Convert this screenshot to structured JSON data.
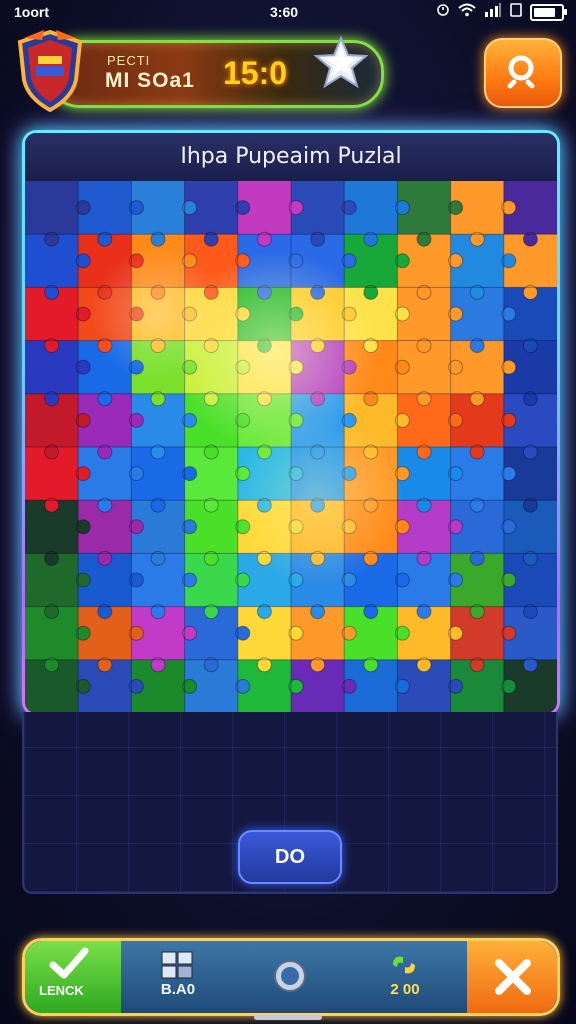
{
  "status_bar": {
    "left_text": "1oort",
    "time": "3:60"
  },
  "header": {
    "label_top": "PECTI",
    "label_main": "MI SOa1",
    "score": "15:0"
  },
  "puzzle": {
    "title": "Ihpa Pupeaim Puzlal",
    "rows": 10,
    "cols": 10,
    "colors": [
      [
        "#2b3a9a",
        "#1f5ad0",
        "#2a7fd8",
        "#2f3fae",
        "#c23ac0",
        "#2a4ab8",
        "#1f78d8",
        "#2d7a3a",
        "#ff9a2a",
        "#4a2a9a"
      ],
      [
        "#1f4fd0",
        "#e8301a",
        "#ff8a1a",
        "#ff5a1a",
        "#2a6ae8",
        "#2a6ae8",
        "#18a83a",
        "#ff9a2a",
        "#1f8ae0",
        "#ff9a2a"
      ],
      [
        "#e21a2a",
        "#f24a1a",
        "#ffbe2a",
        "#ffd83a",
        "#1fb82a",
        "#ffca2a",
        "#ffe24a",
        "#ff9a2a",
        "#2a7ae0",
        "#1a4ab8"
      ],
      [
        "#2a3ac0",
        "#1a6ae8",
        "#7ae02a",
        "#c8f03a",
        "#ffe04a",
        "#b43ac8",
        "#ff8a1a",
        "#ff9a2a",
        "#ff9a2a",
        "#1a3aa8"
      ],
      [
        "#c21a2a",
        "#9a2ab8",
        "#2a8ae8",
        "#4ae02a",
        "#6ae83a",
        "#2a9af0",
        "#ffba2a",
        "#ff6a1a",
        "#e23a1a",
        "#2a4ac0"
      ],
      [
        "#e21a2a",
        "#2a7ae8",
        "#1a6ae8",
        "#5ae83a",
        "#2ab8e8",
        "#2a9af0",
        "#ff9a2a",
        "#1a8ae8",
        "#2a7ae8",
        "#1a3a9a"
      ],
      [
        "#1a3a2a",
        "#9a2aa8",
        "#2a7ad8",
        "#4ae02a",
        "#ffd83a",
        "#ffb82a",
        "#ff8a1a",
        "#b43ac8",
        "#2a6ad8",
        "#1a5ab8"
      ],
      [
        "#1f6a2a",
        "#1a5ad0",
        "#2a7ae8",
        "#3ad84a",
        "#2aa8e8",
        "#2a8ae8",
        "#1a6ae8",
        "#2a7ae8",
        "#3aa82a",
        "#1a4ab8"
      ],
      [
        "#1f8a2a",
        "#e2601a",
        "#c23ac8",
        "#2a6ad8",
        "#ffd83a",
        "#ff9a2a",
        "#4ae02a",
        "#ffba2a",
        "#d23a2a",
        "#2a5ac8"
      ],
      [
        "#1a5a2a",
        "#2a4ab8",
        "#1a8a2a",
        "#2a7ad8",
        "#1fb83a",
        "#6a2ab8",
        "#1a6ad8",
        "#2a4ab8",
        "#1a8a3a",
        "#1a3a2a"
      ]
    ]
  },
  "action": {
    "do_label": "DO"
  },
  "bottom_bar": {
    "check_label": "LENCK",
    "item2_label": "B.A0",
    "item4_label": "2 00"
  },
  "colors": {
    "accent_green": "#7fe04a",
    "accent_orange": "#ff7a12",
    "panel_glow": "#3fd8ff"
  },
  "icons": [
    "shield-icon",
    "star-icon",
    "search-icon",
    "check-icon",
    "grid-icon",
    "circle-icon",
    "coins-icon",
    "close-icon"
  ]
}
